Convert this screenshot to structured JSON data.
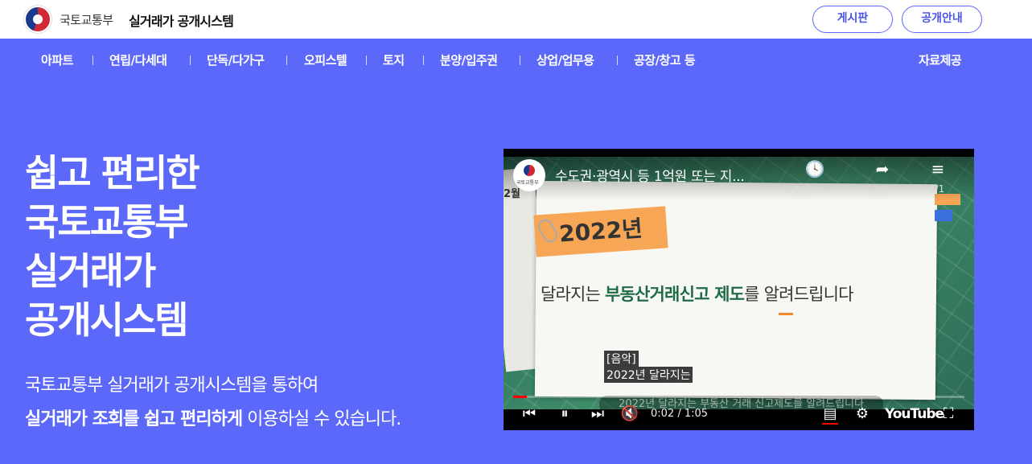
{
  "header": {
    "ministry": "국토교통부",
    "system_name": "실거래가 공개시스템",
    "board_button": "게시판",
    "guide_button": "공개안내"
  },
  "nav": {
    "items": [
      "아파트",
      "연립/다세대",
      "단독/다가구",
      "오피스텔",
      "토지",
      "분양/입주권",
      "상업/업무용",
      "공장/창고 등"
    ],
    "data_provision": "자료제공"
  },
  "hero": {
    "title_lines": [
      "쉽고 편리한",
      "국토교통부",
      "실거래가",
      "공개시스템"
    ],
    "sub_line1": "국토교통부 실거래가 공개시스템을 통하여",
    "sub_line2_bold": "실거래가 조회를 쉽고 편리하게",
    "sub_line2_rest": " 이용하실 수 있습니다."
  },
  "video": {
    "title": "수도권·광역시 등 1억원 또는 지...",
    "channel_logo_text": "국토교통부",
    "watch_later": "나중에 시...",
    "share": "공유",
    "playlist": "1/1",
    "month_label": "2월",
    "year_tag": "2022년",
    "headline_pre": "달라지는 ",
    "headline_bold": "부동산거래신고 제도",
    "headline_post": "를 알려드립니다",
    "caption_line1": "[음악]",
    "caption_line2": "2022년 달라지는",
    "caption_faint": "2022년 달라지는 부동산 거래 신고제도를 알려드립니다",
    "time": "0:02 / 1:05",
    "progress_fraction": 0.03,
    "youtube_label": "YouTube",
    "accent_color": "#ff0000"
  },
  "colors": {
    "brand": "#5c68f9",
    "button_text": "#4a55e8"
  }
}
